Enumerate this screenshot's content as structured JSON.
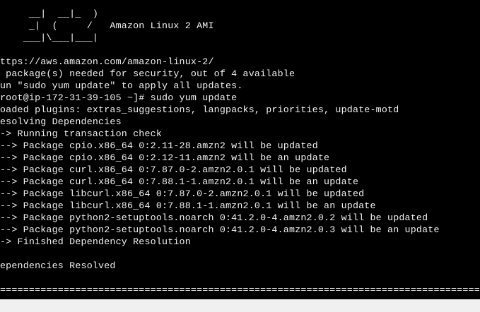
{
  "terminal": {
    "background": "#000000",
    "foreground": "#f2f2f2",
    "lines": [
      "     __|  __|_  )",
      "     _|  (     /   Amazon Linux 2 AMI",
      "    ___|\\___|___|",
      "",
      "ttps://aws.amazon.com/amazon-linux-2/",
      " package(s) needed for security, out of 4 available",
      "un \"sudo yum update\" to apply all updates.",
      "root@ip-172-31-39-105 ~]# sudo yum update",
      "oaded plugins: extras_suggestions, langpacks, priorities, update-motd",
      "esolving Dependencies",
      "-> Running transaction check",
      "--> Package cpio.x86_64 0:2.11-28.amzn2 will be updated",
      "--> Package cpio.x86_64 0:2.12-11.amzn2 will be an update",
      "--> Package curl.x86_64 0:7.87.0-2.amzn2.0.1 will be updated",
      "--> Package curl.x86_64 0:7.88.1-1.amzn2.0.1 will be an update",
      "--> Package libcurl.x86_64 0:7.87.0-2.amzn2.0.1 will be updated",
      "--> Package libcurl.x86_64 0:7.88.1-1.amzn2.0.1 will be an update",
      "--> Package python2-setuptools.noarch 0:41.2.0-4.amzn2.0.2 will be updated",
      "--> Package python2-setuptools.noarch 0:41.2.0-4.amzn2.0.3 will be an update",
      "-> Finished Dependency Resolution",
      "",
      "ependencies Resolved",
      "",
      "================================================================================================"
    ]
  }
}
